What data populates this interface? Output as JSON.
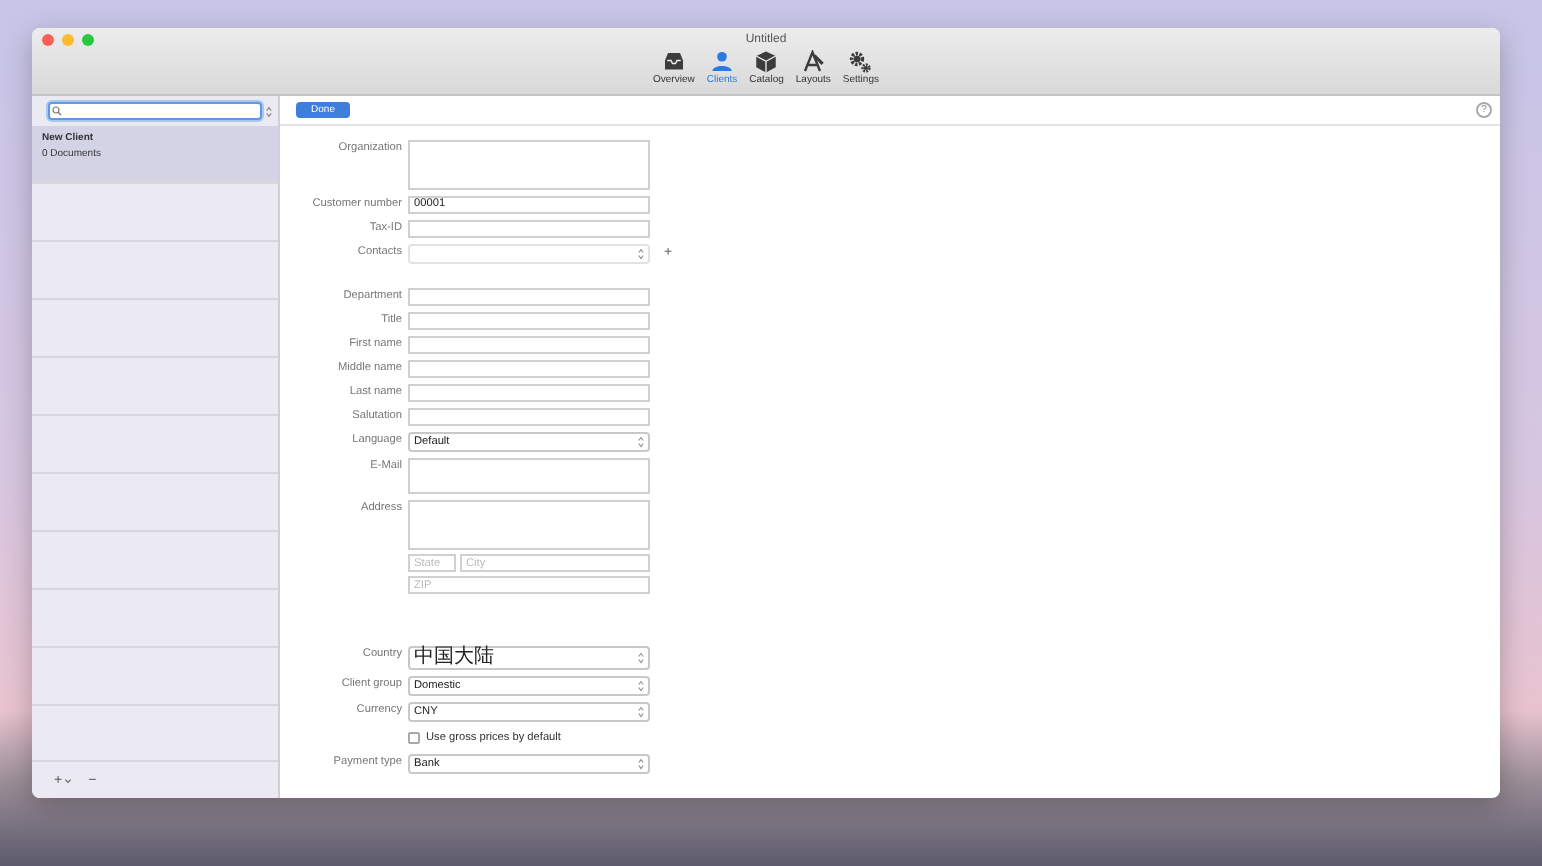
{
  "window": {
    "title": "Untitled",
    "toolbar": [
      {
        "kind": "tray",
        "label": "Overview",
        "selected": false
      },
      {
        "kind": "person",
        "label": "Clients",
        "selected": true
      },
      {
        "kind": "box",
        "label": "Catalog",
        "selected": false
      },
      {
        "kind": "layouts",
        "label": "Layouts",
        "selected": false
      },
      {
        "kind": "gears",
        "label": "Settings",
        "selected": false
      }
    ]
  },
  "sidebar": {
    "items": [
      {
        "title": "New Client",
        "subtitle": "0 Documents",
        "selected": true
      }
    ],
    "footer": {
      "add": "+",
      "remove": "−"
    }
  },
  "action_bar": {
    "done": "Done",
    "help": "?"
  },
  "form": {
    "sections": [
      [
        {
          "kind": "area",
          "label": "Organization"
        },
        {
          "kind": "text",
          "label": "Customer number",
          "value": "00001"
        },
        {
          "kind": "text",
          "label": "Tax-ID"
        },
        {
          "kind": "popup",
          "label": "Contacts",
          "disabled": true,
          "add": "+"
        }
      ],
      [
        {
          "kind": "text",
          "label": "Department"
        },
        {
          "kind": "text",
          "label": "Title"
        },
        {
          "kind": "text",
          "label": "First name"
        },
        {
          "kind": "text",
          "label": "Middle name"
        },
        {
          "kind": "text",
          "label": "Last name"
        },
        {
          "kind": "text",
          "label": "Salutation"
        },
        {
          "kind": "popup",
          "label": "Language",
          "value": "Default",
          "disabled": false
        },
        {
          "kind": "memo",
          "label": "E-Mail"
        },
        {
          "kind": "address",
          "label": "Address",
          "state_placeholder": "State",
          "city_placeholder": "City",
          "zip_placeholder": "ZIP"
        }
      ],
      [
        {
          "kind": "popup",
          "label": "Country",
          "value": "中国大陆",
          "disabled": false
        },
        {
          "kind": "popup",
          "label": "Client group",
          "value": "Domestic",
          "disabled": false
        },
        {
          "kind": "popup",
          "label": "Currency",
          "value": "CNY",
          "disabled": false
        },
        {
          "kind": "checkbox",
          "label": "Use gross prices by default",
          "checked": false
        },
        {
          "kind": "popup",
          "label": "Payment type",
          "value": "Bank",
          "disabled": false
        }
      ]
    ]
  }
}
